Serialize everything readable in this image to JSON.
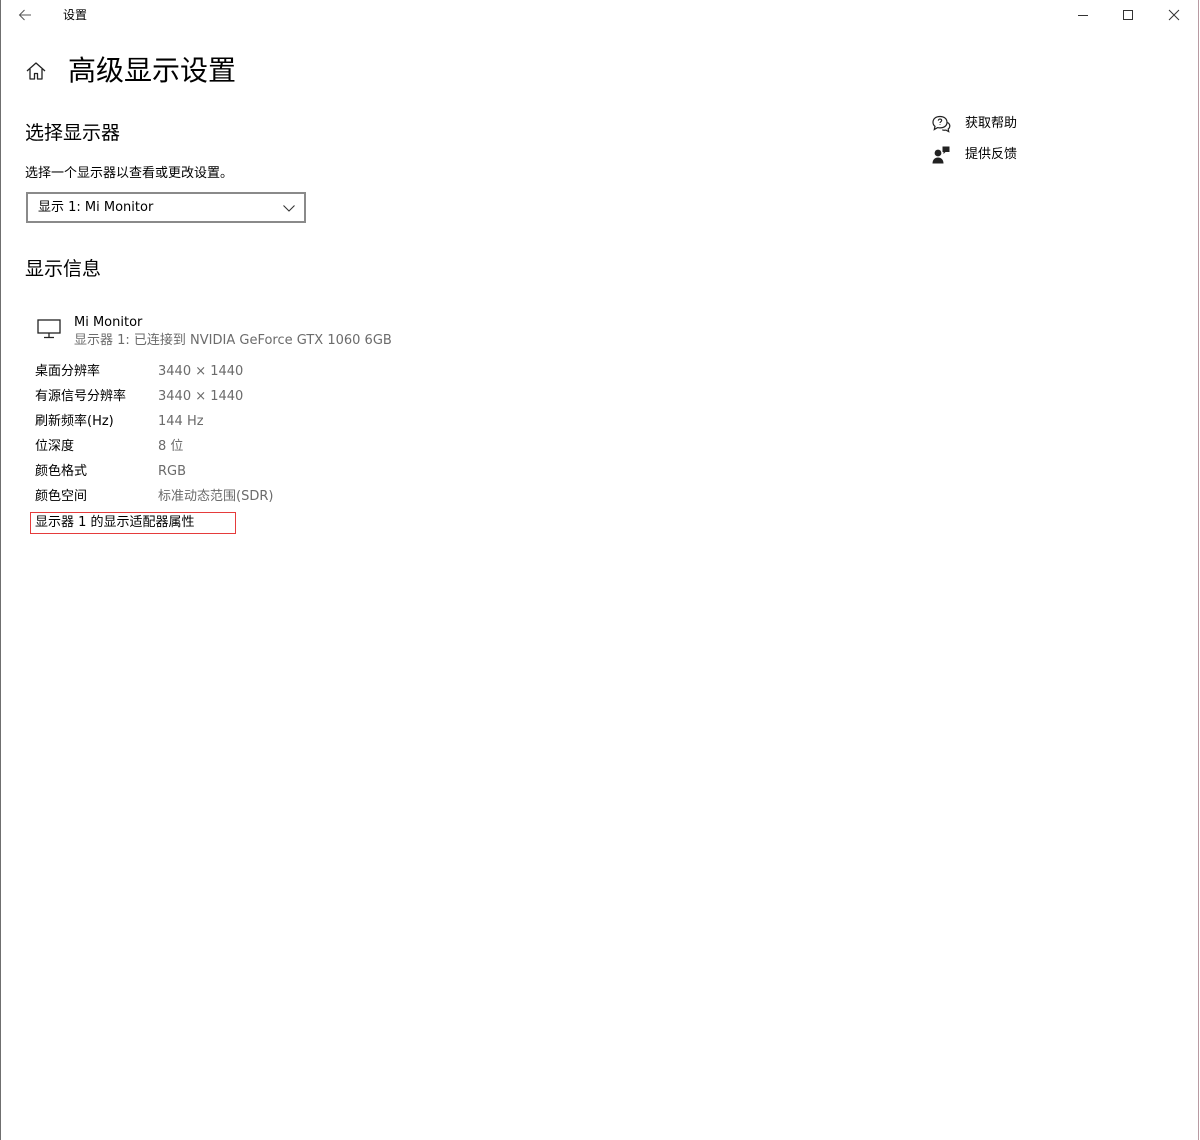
{
  "window": {
    "app_title": "设置"
  },
  "page": {
    "title": "高级显示设置"
  },
  "select_display": {
    "heading": "选择显示器",
    "description": "选择一个显示器以查看或更改设置。",
    "dropdown_value": "显示 1: Mi Monitor"
  },
  "display_info": {
    "heading": "显示信息",
    "monitor_name": "Mi Monitor",
    "monitor_connection": "显示器 1: 已连接到 NVIDIA GeForce GTX 1060 6GB",
    "rows": [
      {
        "label": "桌面分辨率",
        "value": "3440 × 1440"
      },
      {
        "label": "有源信号分辨率",
        "value": "3440 × 1440"
      },
      {
        "label": "刷新频率(Hz)",
        "value": "144 Hz"
      },
      {
        "label": "位深度",
        "value": "8 位"
      },
      {
        "label": "颜色格式",
        "value": "RGB"
      },
      {
        "label": "颜色空间",
        "value": "标准动态范围(SDR)"
      }
    ],
    "adapter_link": "显示器 1 的显示适配器属性"
  },
  "help": {
    "get_help": "获取帮助",
    "feedback": "提供反馈"
  },
  "colors": {
    "highlight_border": "#e53b3b",
    "secondary_text": "#6b6b6b"
  }
}
